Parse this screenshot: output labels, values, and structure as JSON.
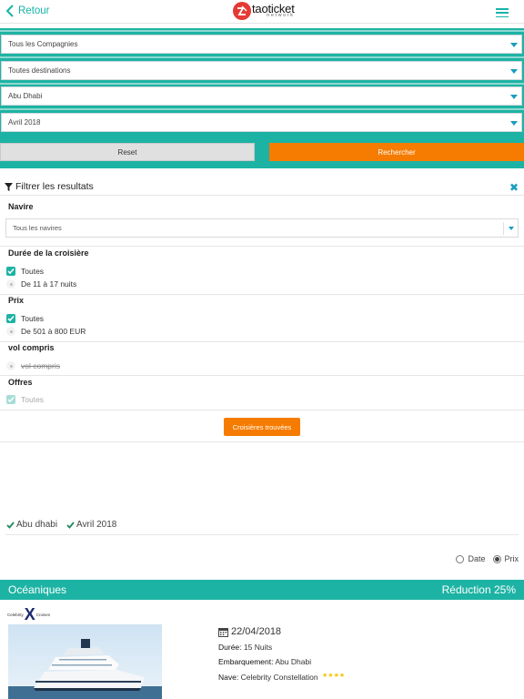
{
  "header": {
    "back_label": "Retour",
    "logo_text": "taoticket",
    "logo_sub": "network"
  },
  "search": {
    "company": "Tous les Compagnies",
    "destination": "Toutes destinations",
    "port": "Abu Dhabi",
    "month": "Avril 2018",
    "reset_label": "Reset",
    "search_label": "Rechercher"
  },
  "filters": {
    "title": "Filtrer les resultats",
    "ship_title": "Navire",
    "ship_value": "Tous les navires",
    "duration_title": "Durée de la croisière",
    "duration_all": "Toutes",
    "duration_option": "De 11 à 17 nuits",
    "price_title": "Prix",
    "price_all": "Toutes",
    "price_option": "De 501 à 800 EUR",
    "flight_title": "vol compris",
    "flight_option": "vol compris",
    "offers_title": "Offres",
    "offers_all": "Toutes",
    "found_label": "Croisières trouvées"
  },
  "selected_tags": [
    "Abu dhabi",
    "Avril 2018"
  ],
  "sort": {
    "date_label": "Date",
    "price_label": "Prix",
    "selected": "Prix"
  },
  "result": {
    "category": "Océaniques",
    "discount": "Réduction 25%",
    "brand_left": "Celebrity",
    "brand_right": "Cruises",
    "date": "22/04/2018",
    "duration_label": "Durée:",
    "duration_value": "15 Nuits",
    "embark_label": "Embarquement:",
    "embark_value": "Abu Dhabi",
    "ship_label": "Nave:",
    "ship_value": "Celebrity Constellation",
    "rating": 4
  },
  "colors": {
    "teal": "#1db3a4",
    "orange": "#f57c00",
    "link_blue": "#1a9dc0"
  }
}
